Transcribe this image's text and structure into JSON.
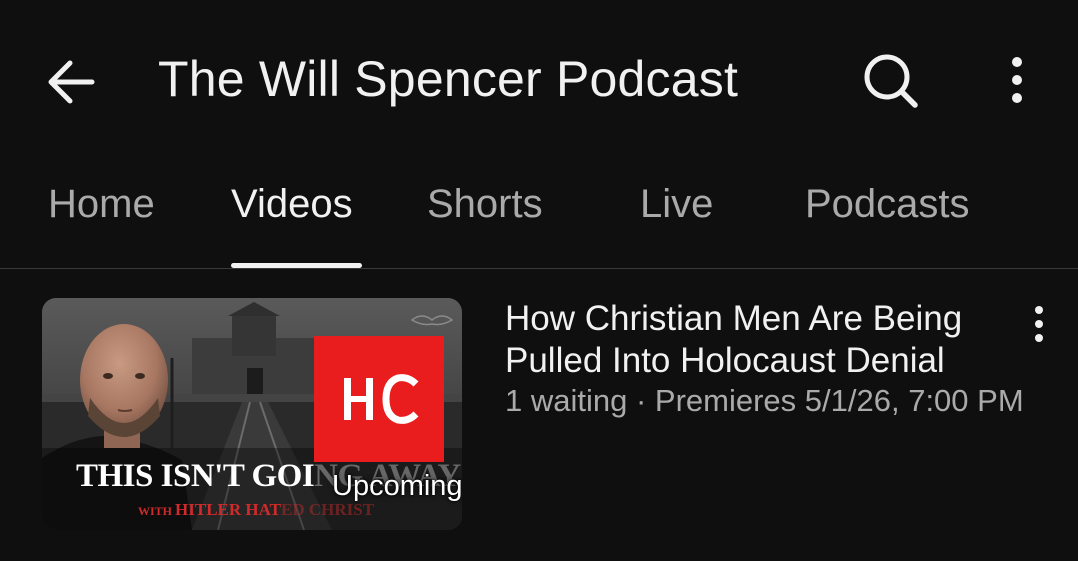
{
  "header": {
    "title": "The Will Spencer Podcast",
    "back_icon": "arrow-left-icon",
    "search_icon": "search-icon",
    "more_icon": "more-vertical-icon"
  },
  "tabs": [
    {
      "label": "Home",
      "active": false
    },
    {
      "label": "Videos",
      "active": true
    },
    {
      "label": "Shorts",
      "active": false
    },
    {
      "label": "Live",
      "active": false
    },
    {
      "label": "Podcasts",
      "active": false
    }
  ],
  "videos": [
    {
      "title": "How Christian Men Are Being Pulled Into Holocaust Denial",
      "waiting": "1 waiting",
      "separator": " · ",
      "premiere": "Premieres 5/1/26, 7:00 PM",
      "badge": "Upcoming",
      "thumbnail": {
        "headline": "THIS ISN'T GOI",
        "headline_faded": "NG AWAY",
        "sub_prefix": "WITH ",
        "sub": "HITLER HAT",
        "sub_faded": "ED CHRIST",
        "logo": "H C"
      }
    }
  ],
  "colors": {
    "background": "#0f0f0f",
    "text_primary": "#f1f1f1",
    "text_secondary": "#aaaaaa",
    "logo_red": "#e91d1d"
  }
}
